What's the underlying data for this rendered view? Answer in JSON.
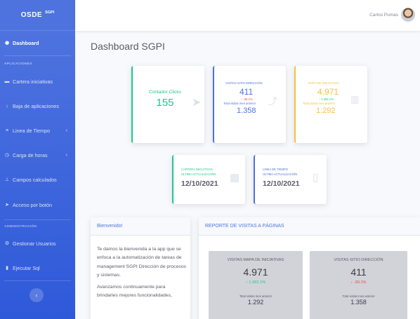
{
  "brand": {
    "name": "OSDE",
    "sup": "SGPI"
  },
  "sidebar": {
    "items": [
      {
        "label": "Dashboard",
        "icon": "tachometer-icon"
      },
      {
        "label": "Cartera iniciativas",
        "icon": "folder-icon"
      },
      {
        "label": "Baja de aplicaciones",
        "icon": "download-icon"
      },
      {
        "label": "Linea de Tiempo",
        "icon": "stream-icon"
      },
      {
        "label": "Carga de horas",
        "icon": "clock-icon"
      },
      {
        "label": "Campos calculados",
        "icon": "sitemap-icon"
      },
      {
        "label": "Acceso por botón",
        "icon": "pointer-icon"
      },
      {
        "label": "Gestionar Usuarios",
        "icon": "users-cog-icon"
      },
      {
        "label": "Ejecutar Sql",
        "icon": "file-icon"
      }
    ],
    "section_apps": "APLICACIONES",
    "section_admin": "ADMINISTRACIÓN"
  },
  "topbar": {
    "user_name": "Carlos Pumas"
  },
  "page": {
    "title": "Dashboard SGPI"
  },
  "cards": {
    "clicks": {
      "label": "Contador Clicks",
      "value": "155"
    },
    "visitas_sitio": {
      "label": "VISITAS SITIO DIRECCIÓN",
      "value": "411",
      "change": "↓ -30.1%",
      "prev_label": "Total visitas mes anterior",
      "prev_value": "1.358"
    },
    "mapa": {
      "label": "MAPA DE INICIATIVAS",
      "value": "4.971",
      "change": "↑ 1.362.1%",
      "prev_label": "Total visitas mes anterior",
      "prev_value": "1.292"
    },
    "cartera": {
      "label1": "CARTERA INICIATIVAS",
      "label2": "ÚLTIMA ACTUALIZACIÓN",
      "date": "12/10/2021"
    },
    "linea": {
      "label1": "LINEA DE TIEMPO",
      "label2": "ÚLTIMA ACTUALIZACIÓN",
      "date": "12/10/2021"
    }
  },
  "welcome": {
    "title": "Bienvenido!",
    "p1": "Te damos la bienvenida a la app que se enfoca a la automatización de tareas de management SGPI Dirección de procesos y sistemas.",
    "p2": "Avanzamos continuamente para brindarles mejores funcionalidades,"
  },
  "report": {
    "title": "REPORTE DE VISITAS A PÁGINAS",
    "mapa": {
      "label": "VISITAS MAPA DE INICIATIVAS",
      "value": "4.971",
      "change": "↑ 1.362.1%",
      "prev_label": "Total visitas mes anterior",
      "prev_value": "1.292"
    },
    "sitio": {
      "label": "VISITAS SITIO DIRECCIÓN",
      "value": "411",
      "change": "↓ -30.1%",
      "prev_label": "Total visitas mes anterior",
      "prev_value": "1.358"
    }
  },
  "colors": {
    "primary": "#4e73df",
    "success": "#1cc88a",
    "warning": "#f6c23e",
    "danger": "#e74a3b"
  }
}
